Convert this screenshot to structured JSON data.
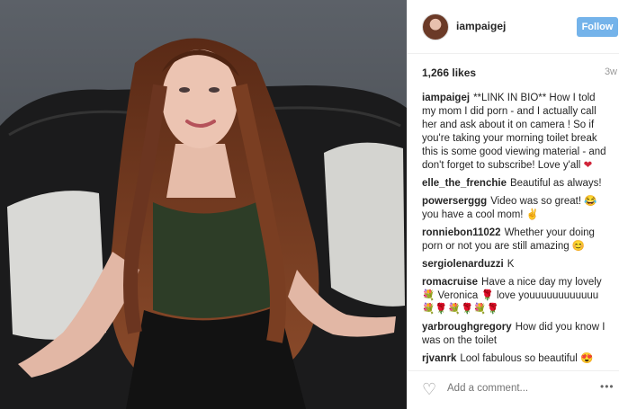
{
  "post": {
    "image_alt": "Photo of woman sitting on a leather couch with white pillows",
    "username": "iampaigej",
    "follow_label": "Follow",
    "likes": "1,266 likes",
    "age": "3w"
  },
  "comments": [
    {
      "user": "iampaigej",
      "text": "**LINK IN BIO** How I told my mom I did porn - and I actually call her and ask about it on camera ! So if you're taking your morning toilet break this is some good viewing material - and don't forget to subscribe! Love y'all",
      "emoji": "❤"
    },
    {
      "user": "elle_the_frenchie",
      "text": "Beautiful as always!",
      "emoji": ""
    },
    {
      "user": "powerserggg",
      "text": "Video was so great! 😂 you have a cool mom!",
      "emoji": "✌"
    },
    {
      "user": "ronniebon11022",
      "text": "Whether your doing porn or not you are still amazing",
      "emoji": "😊"
    },
    {
      "user": "sergiolenarduzzi",
      "text": "K",
      "emoji": ""
    },
    {
      "user": "romacruise",
      "text": "Have a nice day my lovely 💐 Veronica 🌹 love youuuuuuuuuuuu 💐🌹💐🌹💐🌹",
      "emoji": ""
    },
    {
      "user": "yarbroughgregory",
      "text": "How did you know I was on the toilet",
      "emoji": ""
    },
    {
      "user": "rjvanrk",
      "text": "Lool fabulous so beautiful 😍",
      "emoji": "😍"
    }
  ],
  "footer": {
    "placeholder": "Add a comment...",
    "more": "•••"
  }
}
